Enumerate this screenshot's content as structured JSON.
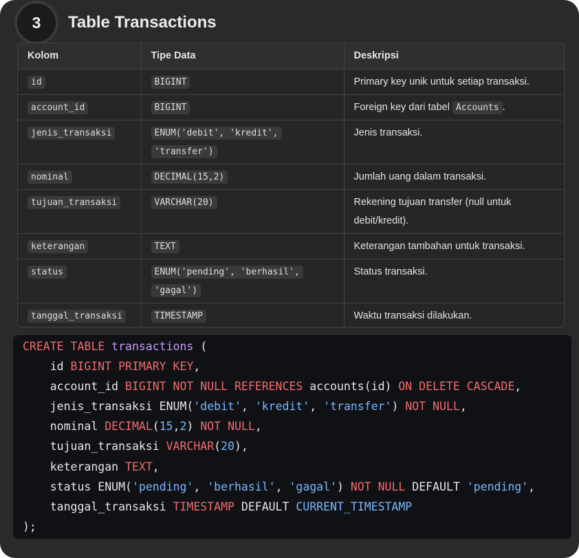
{
  "header": {
    "step_number": "3",
    "title": "Table Transactions"
  },
  "table": {
    "columns": [
      "Kolom",
      "Tipe Data",
      "Deskripsi"
    ],
    "rows": [
      {
        "kolom": "id",
        "tipe": "BIGINT",
        "desc": "Primary key unik untuk setiap transaksi.",
        "desc_code": "",
        "desc_suffix": ""
      },
      {
        "kolom": "account_id",
        "tipe": "BIGINT",
        "desc": "Foreign key dari tabel ",
        "desc_code": "Accounts",
        "desc_suffix": "."
      },
      {
        "kolom": "jenis_transaksi",
        "tipe": "ENUM('debit', 'kredit', 'transfer')",
        "desc": "Jenis transaksi.",
        "desc_code": "",
        "desc_suffix": ""
      },
      {
        "kolom": "nominal",
        "tipe": "DECIMAL(15,2)",
        "desc": "Jumlah uang dalam transaksi.",
        "desc_code": "",
        "desc_suffix": ""
      },
      {
        "kolom": "tujuan_transaksi",
        "tipe": "VARCHAR(20)",
        "desc": "Rekening tujuan transfer (null untuk debit/kredit).",
        "desc_code": "",
        "desc_suffix": ""
      },
      {
        "kolom": "keterangan",
        "tipe": "TEXT",
        "desc": "Keterangan tambahan untuk transaksi.",
        "desc_code": "",
        "desc_suffix": ""
      },
      {
        "kolom": "status",
        "tipe": "ENUM('pending', 'berhasil', 'gagal')",
        "desc": "Status transaksi.",
        "desc_code": "",
        "desc_suffix": ""
      },
      {
        "kolom": "tanggal_transaksi",
        "tipe": "TIMESTAMP",
        "desc": "Waktu transaksi dilakukan.",
        "desc_code": "",
        "desc_suffix": ""
      }
    ]
  },
  "code": {
    "lines": [
      [
        [
          "kw",
          "CREATE TABLE "
        ],
        [
          "fn",
          "transactions"
        ],
        [
          "pl",
          " ("
        ]
      ],
      [
        [
          "pl",
          "    id "
        ],
        [
          "kw",
          "BIGINT PRIMARY KEY"
        ],
        [
          "pl",
          ","
        ]
      ],
      [
        [
          "pl",
          "    account_id "
        ],
        [
          "kw",
          "BIGINT NOT NULL REFERENCES"
        ],
        [
          "pl",
          " accounts(id) "
        ],
        [
          "kw",
          "ON DELETE CASCADE"
        ],
        [
          "pl",
          ","
        ]
      ],
      [
        [
          "pl",
          "    jenis_transaksi ENUM("
        ],
        [
          "str",
          "'debit'"
        ],
        [
          "pl",
          ", "
        ],
        [
          "str",
          "'kredit'"
        ],
        [
          "pl",
          ", "
        ],
        [
          "str",
          "'transfer'"
        ],
        [
          "pl",
          ") "
        ],
        [
          "kw",
          "NOT NULL"
        ],
        [
          "pl",
          ","
        ]
      ],
      [
        [
          "pl",
          "    nominal "
        ],
        [
          "kw",
          "DECIMAL"
        ],
        [
          "pl",
          "("
        ],
        [
          "num",
          "15"
        ],
        [
          "pl",
          ","
        ],
        [
          "num",
          "2"
        ],
        [
          "pl",
          ") "
        ],
        [
          "kw",
          "NOT NULL"
        ],
        [
          "pl",
          ","
        ]
      ],
      [
        [
          "pl",
          "    tujuan_transaksi "
        ],
        [
          "kw",
          "VARCHAR"
        ],
        [
          "pl",
          "("
        ],
        [
          "num",
          "20"
        ],
        [
          "pl",
          "),"
        ]
      ],
      [
        [
          "pl",
          "    keterangan "
        ],
        [
          "kw",
          "TEXT"
        ],
        [
          "pl",
          ","
        ]
      ],
      [
        [
          "pl",
          "    status ENUM("
        ],
        [
          "str",
          "'pending'"
        ],
        [
          "pl",
          ", "
        ],
        [
          "str",
          "'berhasil'"
        ],
        [
          "pl",
          ", "
        ],
        [
          "str",
          "'gagal'"
        ],
        [
          "pl",
          ") "
        ],
        [
          "kw",
          "NOT NULL"
        ],
        [
          "pl",
          " DEFAULT "
        ],
        [
          "str",
          "'pending'"
        ],
        [
          "pl",
          ","
        ]
      ],
      [
        [
          "pl",
          "    tanggal_transaksi "
        ],
        [
          "kw",
          "TIMESTAMP"
        ],
        [
          "pl",
          " DEFAULT "
        ],
        [
          "const",
          "CURRENT_TIMESTAMP"
        ]
      ],
      [
        [
          "pl",
          ");"
        ]
      ]
    ]
  }
}
